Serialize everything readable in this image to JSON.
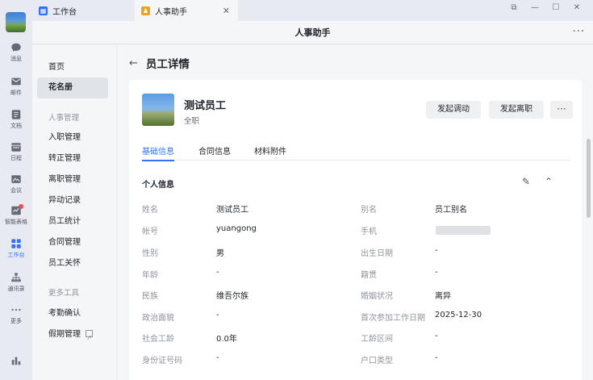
{
  "rail": {
    "items": [
      {
        "name": "rail-messages",
        "icon": "chat-icon",
        "label": "消息"
      },
      {
        "name": "rail-mail",
        "icon": "mail-icon",
        "label": "邮件"
      },
      {
        "name": "rail-docs",
        "icon": "document-icon",
        "label": "文档"
      },
      {
        "name": "rail-calendar",
        "icon": "calendar-icon",
        "label": "日程"
      },
      {
        "name": "rail-meeting",
        "icon": "meeting-icon",
        "label": "会议"
      },
      {
        "name": "rail-smart-form",
        "icon": "smart-table-icon",
        "label": "智能表格"
      },
      {
        "name": "rail-workbench",
        "icon": "grid-icon",
        "label": "工作台"
      },
      {
        "name": "rail-contacts",
        "icon": "org-chart-icon",
        "label": "通讯录"
      },
      {
        "name": "rail-more",
        "icon": "more-dots-icon",
        "label": "更多"
      }
    ]
  },
  "tabs": {
    "workbench": "工作台",
    "hr_assistant": "人事助手"
  },
  "titlebar": {
    "title": "人事助手"
  },
  "menu": {
    "home": "首页",
    "roster": "花名册",
    "group_hr": "人事管理",
    "onboarding": "入职管理",
    "regularization": "转正管理",
    "offboarding": "离职管理",
    "changes": "异动记录",
    "statistics": "员工统计",
    "contracts": "合同管理",
    "care": "员工关怀",
    "group_tools": "更多工具",
    "attendance": "考勤确认",
    "leave": "假期管理"
  },
  "page": {
    "title": "员工详情",
    "employee": {
      "name": "测试员工",
      "status": "全职"
    },
    "buttons": {
      "transfer": "发起调动",
      "resign": "发起离职"
    },
    "tabs": [
      "基础信息",
      "合同信息",
      "材料附件"
    ],
    "section": "个人信息",
    "fields": {
      "name": {
        "label": "姓名",
        "value": "测试员工"
      },
      "alias": {
        "label": "别名",
        "value": "员工别名"
      },
      "account": {
        "label": "帐号",
        "value": "yuangong"
      },
      "phone": {
        "label": "手机",
        "value": ""
      },
      "gender": {
        "label": "性别",
        "value": "男"
      },
      "birthday": {
        "label": "出生日期",
        "value": "-"
      },
      "age": {
        "label": "年龄",
        "value": "-"
      },
      "native": {
        "label": "籍贯",
        "value": "-"
      },
      "ethnicity": {
        "label": "民族",
        "value": "维吾尔族"
      },
      "marital": {
        "label": "婚姻状况",
        "value": "离异"
      },
      "political": {
        "label": "政治面貌",
        "value": "-"
      },
      "first_work": {
        "label": "首次参加工作日期",
        "value": "2025-12-30"
      },
      "seniority": {
        "label": "社会工龄",
        "value": "0.0年"
      },
      "work_range": {
        "label": "工龄区间",
        "value": "-"
      },
      "id_number": {
        "label": "身份证号码",
        "value": "-"
      },
      "hukou": {
        "label": "户口类型",
        "value": "-"
      }
    }
  }
}
